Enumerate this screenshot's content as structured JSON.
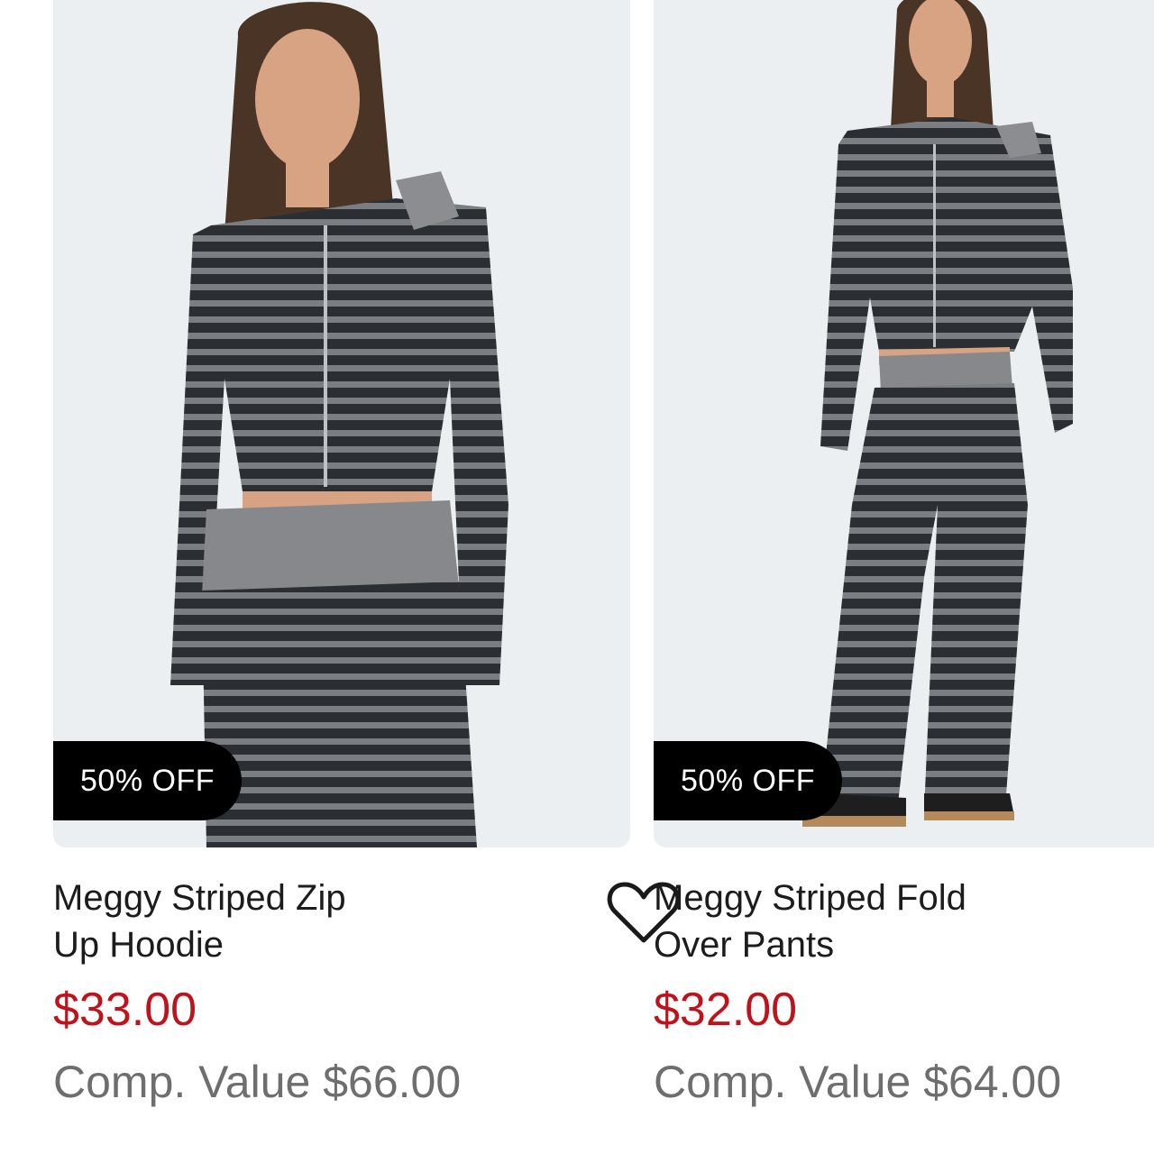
{
  "products": [
    {
      "badge": "50% OFF",
      "title": "Meggy Striped Zip Up Hoodie",
      "price": "$33.00",
      "comp_value": "Comp. Value $66.00"
    },
    {
      "badge": "50% OFF",
      "title": "Meggy Striped Fold Over Pants",
      "price": "$32.00",
      "comp_value": "Comp. Value $64.00"
    }
  ],
  "icons": {
    "favorite": "heart-outline-icon"
  },
  "colors": {
    "price": "#c0121b",
    "badge_bg": "#000000",
    "image_bg": "#ebeff1"
  }
}
